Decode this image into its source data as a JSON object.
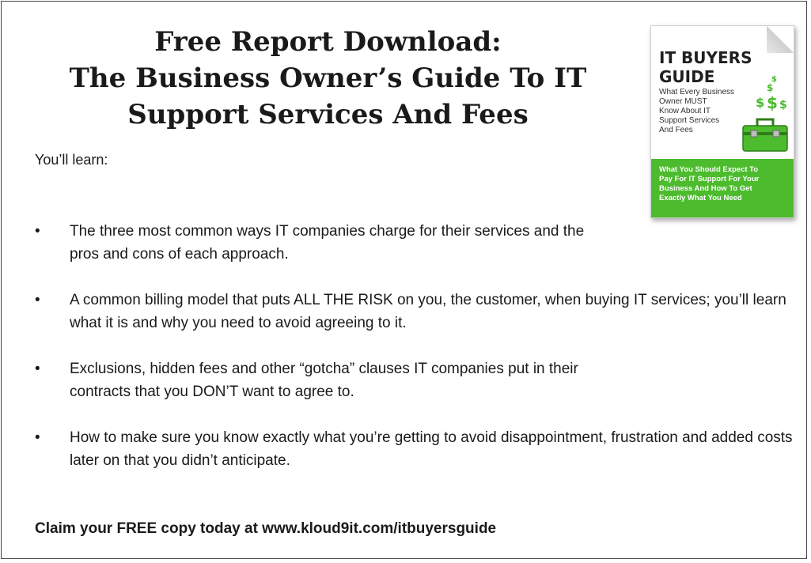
{
  "title_lines": [
    "Free Report Download:",
    "The Business Owner’s Guide To IT",
    "Support Services And Fees"
  ],
  "intro": "You’ll learn:",
  "bullets": [
    "The three most common ways IT companies charge for their services and the pros and cons of each approach.",
    "A common billing model that puts ALL THE RISK on you, the customer, when buying IT services; you’ll learn what it is and why you need to avoid agreeing to it.",
    "Exclusions, hidden fees and other “gotcha” clauses IT companies put in their contracts that you DON’T want to agree to.",
    "How to make sure you know exactly what you’re getting to avoid disappointment, frustration and added costs later on that you didn’t anticipate."
  ],
  "claim": "Claim your FREE copy today at www.kloud9it.com/itbuyersguide",
  "cover": {
    "title_lines": [
      "IT BUYERS",
      "GUIDE"
    ],
    "subtitle_lines": [
      "What Every Business",
      "Owner MUST",
      "Know About IT",
      "Support Services",
      "And Fees"
    ],
    "band_lines": [
      "What You Should Expect To",
      "Pay For IT Support For Your",
      "Business And How To Get",
      "Exactly What You Need"
    ],
    "band_color": "#4cbb2d",
    "icons": [
      "dollar-signs-icon",
      "toolbox-icon"
    ]
  }
}
